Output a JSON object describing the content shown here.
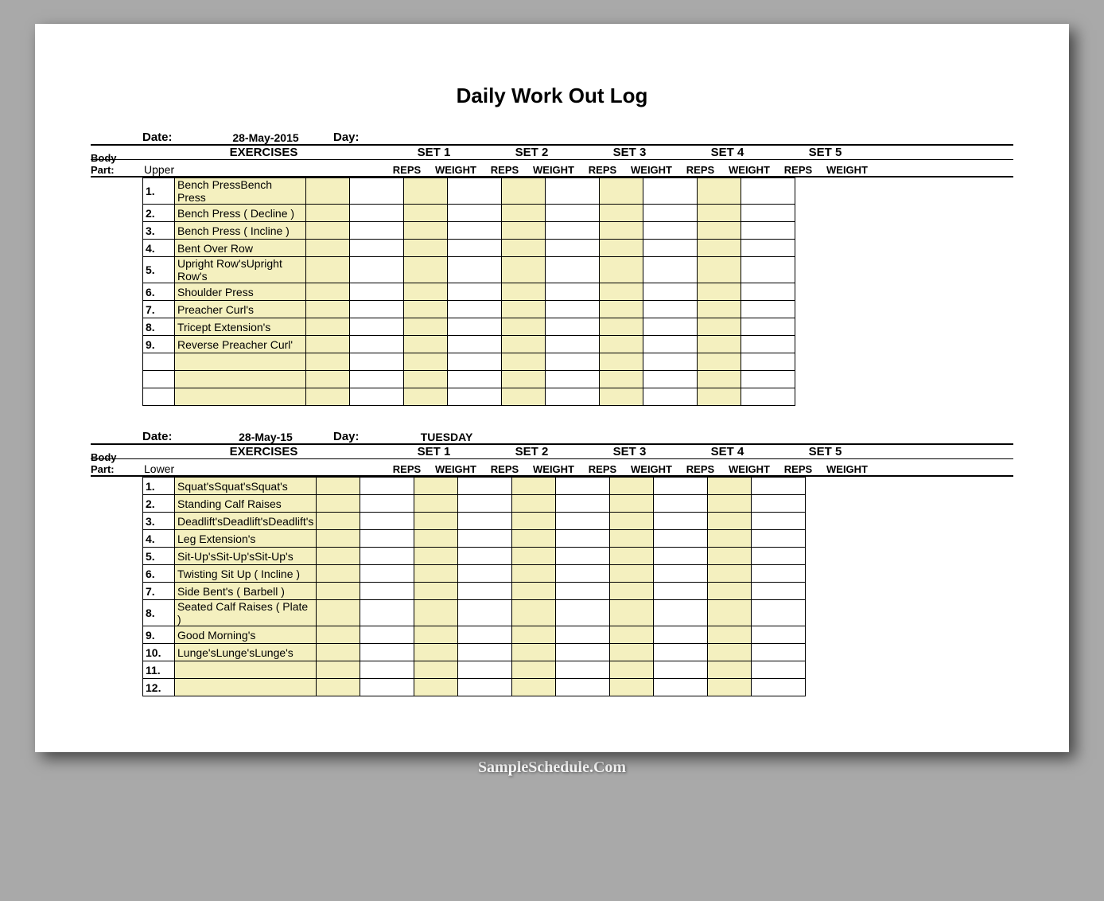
{
  "title": "Daily Work Out Log",
  "labels": {
    "date": "Date:",
    "day": "Day:",
    "exercises": "EXERCISES",
    "body_part": "Body Part:",
    "reps": "REPS",
    "weight": "WEIGHT",
    "set1": "SET 1",
    "set2": "SET 2",
    "set3": "SET 3",
    "set4": "SET 4",
    "set5": "SET 5"
  },
  "sections": [
    {
      "date": "28-May-2015",
      "day": "",
      "body_part": "Upper",
      "rows": [
        {
          "n": "1.",
          "name": "Bench PressBench Press"
        },
        {
          "n": "2.",
          "name": "Bench Press ( Decline )"
        },
        {
          "n": "3.",
          "name": "Bench Press ( Incline )"
        },
        {
          "n": "4.",
          "name": "Bent Over Row"
        },
        {
          "n": "5.",
          "name": "Upright Row'sUpright Row's"
        },
        {
          "n": "6.",
          "name": "Shoulder Press"
        },
        {
          "n": "7.",
          "name": "Preacher Curl's"
        },
        {
          "n": "8.",
          "name": "Tricept Extension's"
        },
        {
          "n": "9.",
          "name": "Reverse Preacher Curl'"
        },
        {
          "n": "",
          "name": ""
        },
        {
          "n": "",
          "name": ""
        },
        {
          "n": "",
          "name": ""
        }
      ]
    },
    {
      "date": "28-May-15",
      "day": "TUESDAY",
      "body_part": "Lower",
      "rows": [
        {
          "n": "1.",
          "name": "Squat'sSquat'sSquat's"
        },
        {
          "n": "2.",
          "name": "Standing Calf Raises"
        },
        {
          "n": "3.",
          "name": "Deadlift'sDeadlift'sDeadlift's"
        },
        {
          "n": "4.",
          "name": "Leg Extension's"
        },
        {
          "n": "5.",
          "name": "Sit-Up'sSit-Up'sSit-Up's"
        },
        {
          "n": "6.",
          "name": "Twisting Sit Up ( Incline )"
        },
        {
          "n": "7.",
          "name": "Side Bent's ( Barbell )"
        },
        {
          "n": "8.",
          "name": "Seated Calf Raises ( Plate )"
        },
        {
          "n": "9.",
          "name": "Good Morning's"
        },
        {
          "n": "10.",
          "name": "Lunge'sLunge'sLunge's"
        },
        {
          "n": "11.",
          "name": ""
        },
        {
          "n": "12.",
          "name": ""
        }
      ]
    }
  ],
  "watermark": "SampleSchedule.Com"
}
